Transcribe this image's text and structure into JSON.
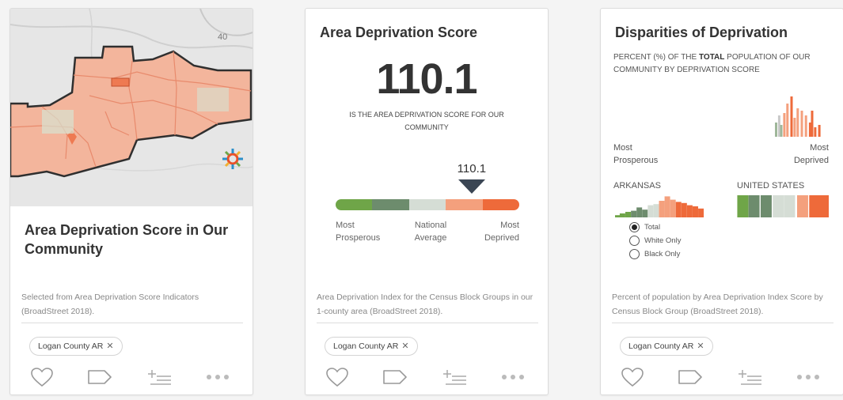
{
  "card1": {
    "map_label": "40",
    "title": "Area Deprivation Score in Our Community",
    "source": "Selected from Area Deprivation Score Indicators (BroadStreet 2018).",
    "tag": "Logan County AR",
    "tag_remove": "✕"
  },
  "card2": {
    "title": "Area Deprivation Score",
    "score": "110.1",
    "subtext": "IS THE AREA DEPRIVATION SCORE FOR OUR COMMUNITY",
    "marker_value": "110.1",
    "marker_fraction": 0.74,
    "scale_colors": [
      "#6fa548",
      "#6d8c6d",
      "#d5ddd5",
      "#f4a07d",
      "#ee6a3a"
    ],
    "scale_labels": {
      "left_line1": "Most",
      "left_line2": "Prosperous",
      "mid_line1": "National",
      "mid_line2": "Average",
      "right_line1": "Most",
      "right_line2": "Deprived"
    },
    "source": "Area Deprivation Index for the Census Block Groups in our 1-county area (BroadStreet 2018).",
    "tag": "Logan County AR",
    "tag_remove": "✕"
  },
  "card3": {
    "title": "Disparities of Deprivation",
    "subtitle_pre": "PERCENT (%) OF THE ",
    "subtitle_bold": "TOTAL",
    "subtitle_post": " POPULATION OF OUR COMMUNITY BY DEPRIVATION SCORE",
    "axis_left_line1": "Most",
    "axis_left_line2": "Prosperous",
    "axis_right_line1": "Most",
    "axis_right_line2": "Deprived",
    "state_label": "ARKANSAS",
    "nation_label": "UNITED STATES",
    "radio_options": [
      "Total",
      "White Only",
      "Black Only"
    ],
    "radio_selected": "Total",
    "source": "Percent of population by Area Deprivation Index Score by Census Block Group (BroadStreet 2018).",
    "tag": "Logan County AR",
    "tag_remove": "✕"
  },
  "chart_data": [
    {
      "type": "bar",
      "name": "community",
      "values": [
        0,
        0,
        0,
        0,
        0,
        0,
        0,
        0,
        0,
        0,
        0,
        0,
        0,
        0,
        0,
        0,
        0,
        0,
        0,
        0,
        0,
        0,
        0,
        0,
        0,
        0,
        0,
        0,
        0,
        0,
        0,
        0,
        0,
        0,
        0,
        0,
        0,
        0,
        0,
        0,
        0,
        0,
        0,
        0,
        0,
        0,
        0,
        0,
        0,
        0,
        0,
        0,
        0,
        0,
        0,
        0,
        0,
        0,
        0,
        0,
        0,
        0,
        0,
        0,
        0,
        0,
        0,
        0,
        0,
        0,
        0,
        0,
        0,
        0,
        0,
        0,
        0,
        0,
        0,
        0,
        0,
        0,
        0,
        0,
        0,
        0,
        0,
        0,
        0,
        0,
        0,
        0,
        0,
        0,
        0,
        0,
        0,
        0,
        0,
        0,
        0,
        0,
        0,
        0,
        0,
        0,
        0,
        0,
        0,
        0,
        0,
        0,
        0,
        0,
        0,
        0,
        0,
        0,
        0,
        0,
        0,
        0,
        0,
        0,
        0,
        0,
        0,
        0,
        0,
        0,
        0,
        0,
        0,
        0,
        0,
        0,
        0,
        0,
        0,
        0,
        0,
        0,
        0,
        0,
        0,
        0,
        0,
        0,
        0,
        0,
        0,
        0,
        0,
        0,
        0,
        0,
        0,
        0,
        0,
        0,
        0,
        0,
        0,
        0,
        0,
        0,
        0,
        0,
        0,
        0,
        0,
        0,
        0,
        0,
        0,
        0,
        0,
        0,
        0,
        0,
        0,
        0,
        0,
        0,
        0,
        0,
        0,
        0,
        0,
        0,
        0,
        0,
        0,
        0,
        0,
        0,
        0,
        0,
        0,
        0,
        0,
        0,
        0,
        0,
        0,
        0,
        0,
        0,
        0,
        0
      ],
      "bars": [
        {
          "pos": 0.55,
          "value": 0.3,
          "color": "#9fb79a"
        },
        {
          "pos": 0.58,
          "value": 0.45,
          "color": "#c9c9c9"
        },
        {
          "pos": 0.6,
          "value": 0.25,
          "color": "#9fb79a"
        },
        {
          "pos": 0.63,
          "value": 0.5,
          "color": "#f4a07d"
        },
        {
          "pos": 0.66,
          "value": 0.7,
          "color": "#f4a07d"
        },
        {
          "pos": 0.7,
          "value": 0.85,
          "color": "#ee6a3a"
        },
        {
          "pos": 0.73,
          "value": 0.4,
          "color": "#f4a07d"
        },
        {
          "pos": 0.76,
          "value": 0.6,
          "color": "#f4a07d"
        },
        {
          "pos": 0.8,
          "value": 0.55,
          "color": "#f4a07d"
        },
        {
          "pos": 0.84,
          "value": 0.45,
          "color": "#f4a07d"
        },
        {
          "pos": 0.88,
          "value": 0.3,
          "color": "#ee6a3a"
        },
        {
          "pos": 0.9,
          "value": 0.55,
          "color": "#ee6a3a"
        },
        {
          "pos": 0.93,
          "value": 0.2,
          "color": "#ee6a3a"
        },
        {
          "pos": 0.97,
          "value": 0.25,
          "color": "#ee6a3a"
        }
      ]
    },
    {
      "type": "area",
      "name": "arkansas",
      "bars": [
        {
          "pos": 0.02,
          "value": 0.1,
          "color": "#6fa548"
        },
        {
          "pos": 0.08,
          "value": 0.18,
          "color": "#6fa548"
        },
        {
          "pos": 0.14,
          "value": 0.25,
          "color": "#6fa548"
        },
        {
          "pos": 0.2,
          "value": 0.3,
          "color": "#6d8c6d"
        },
        {
          "pos": 0.26,
          "value": 0.45,
          "color": "#6d8c6d"
        },
        {
          "pos": 0.32,
          "value": 0.35,
          "color": "#6d8c6d"
        },
        {
          "pos": 0.38,
          "value": 0.55,
          "color": "#d5ddd5"
        },
        {
          "pos": 0.44,
          "value": 0.6,
          "color": "#d5ddd5"
        },
        {
          "pos": 0.5,
          "value": 0.75,
          "color": "#f4a07d"
        },
        {
          "pos": 0.56,
          "value": 0.95,
          "color": "#f4a07d"
        },
        {
          "pos": 0.62,
          "value": 0.8,
          "color": "#f4a07d"
        },
        {
          "pos": 0.68,
          "value": 0.7,
          "color": "#ee6a3a"
        },
        {
          "pos": 0.74,
          "value": 0.65,
          "color": "#ee6a3a"
        },
        {
          "pos": 0.8,
          "value": 0.55,
          "color": "#ee6a3a"
        },
        {
          "pos": 0.86,
          "value": 0.5,
          "color": "#ee6a3a"
        },
        {
          "pos": 0.92,
          "value": 0.4,
          "color": "#ee6a3a"
        }
      ]
    },
    {
      "type": "bar",
      "name": "united-states",
      "bars": [
        {
          "pos": 0.08,
          "value": 1.0,
          "color": "#6fa548"
        },
        {
          "pos": 0.2,
          "value": 1.0,
          "color": "#6d8c6d"
        },
        {
          "pos": 0.33,
          "value": 1.0,
          "color": "#6d8c6d"
        },
        {
          "pos": 0.46,
          "value": 1.0,
          "color": "#d5ddd5"
        },
        {
          "pos": 0.58,
          "value": 1.0,
          "color": "#d5ddd5"
        },
        {
          "pos": 0.72,
          "value": 1.0,
          "color": "#f4a07d"
        },
        {
          "pos": 0.85,
          "value": 1.0,
          "color": "#ee6a3a"
        },
        {
          "pos": 0.97,
          "value": 1.0,
          "color": "#ee6a3a"
        }
      ]
    }
  ]
}
